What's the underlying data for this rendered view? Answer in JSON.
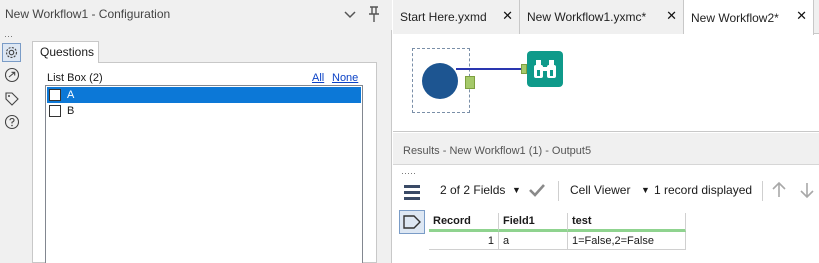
{
  "config": {
    "title": "New Workflow1 - Configuration",
    "tab_label": "Questions",
    "listbox_label": "List Box (2)",
    "link_all": "All",
    "link_none": "None",
    "items": [
      {
        "label": "A",
        "checked": false,
        "selected": true
      },
      {
        "label": "B",
        "checked": false,
        "selected": false
      }
    ],
    "side_icons": [
      "gear-icon",
      "share-icon",
      "tag-icon",
      "help-icon"
    ]
  },
  "doc_tabs": [
    {
      "label": "Start Here.yxmd",
      "active": false
    },
    {
      "label": "New Workflow1.yxmc*",
      "active": false
    },
    {
      "label": "New Workflow2*",
      "active": true
    }
  ],
  "canvas": {
    "tools": [
      "input-tool",
      "browse-tool"
    ]
  },
  "results": {
    "title": "Results - New Workflow1 (1) - Output5",
    "fields_label": "2 of 2 Fields",
    "viewer_label": "Cell Viewer",
    "records_label": "1 record displayed",
    "columns": [
      "Record",
      "Field1",
      "test"
    ],
    "rows": [
      [
        "1",
        "a",
        "1=False,2=False"
      ]
    ]
  },
  "colors": {
    "selection": "#0c78d7",
    "input_tool": "#1d5591",
    "browse_tool": "#0f9a8a",
    "connector": "#2a36b0",
    "anchor": "#a5c96a",
    "header_accent": "#8fd38f"
  }
}
